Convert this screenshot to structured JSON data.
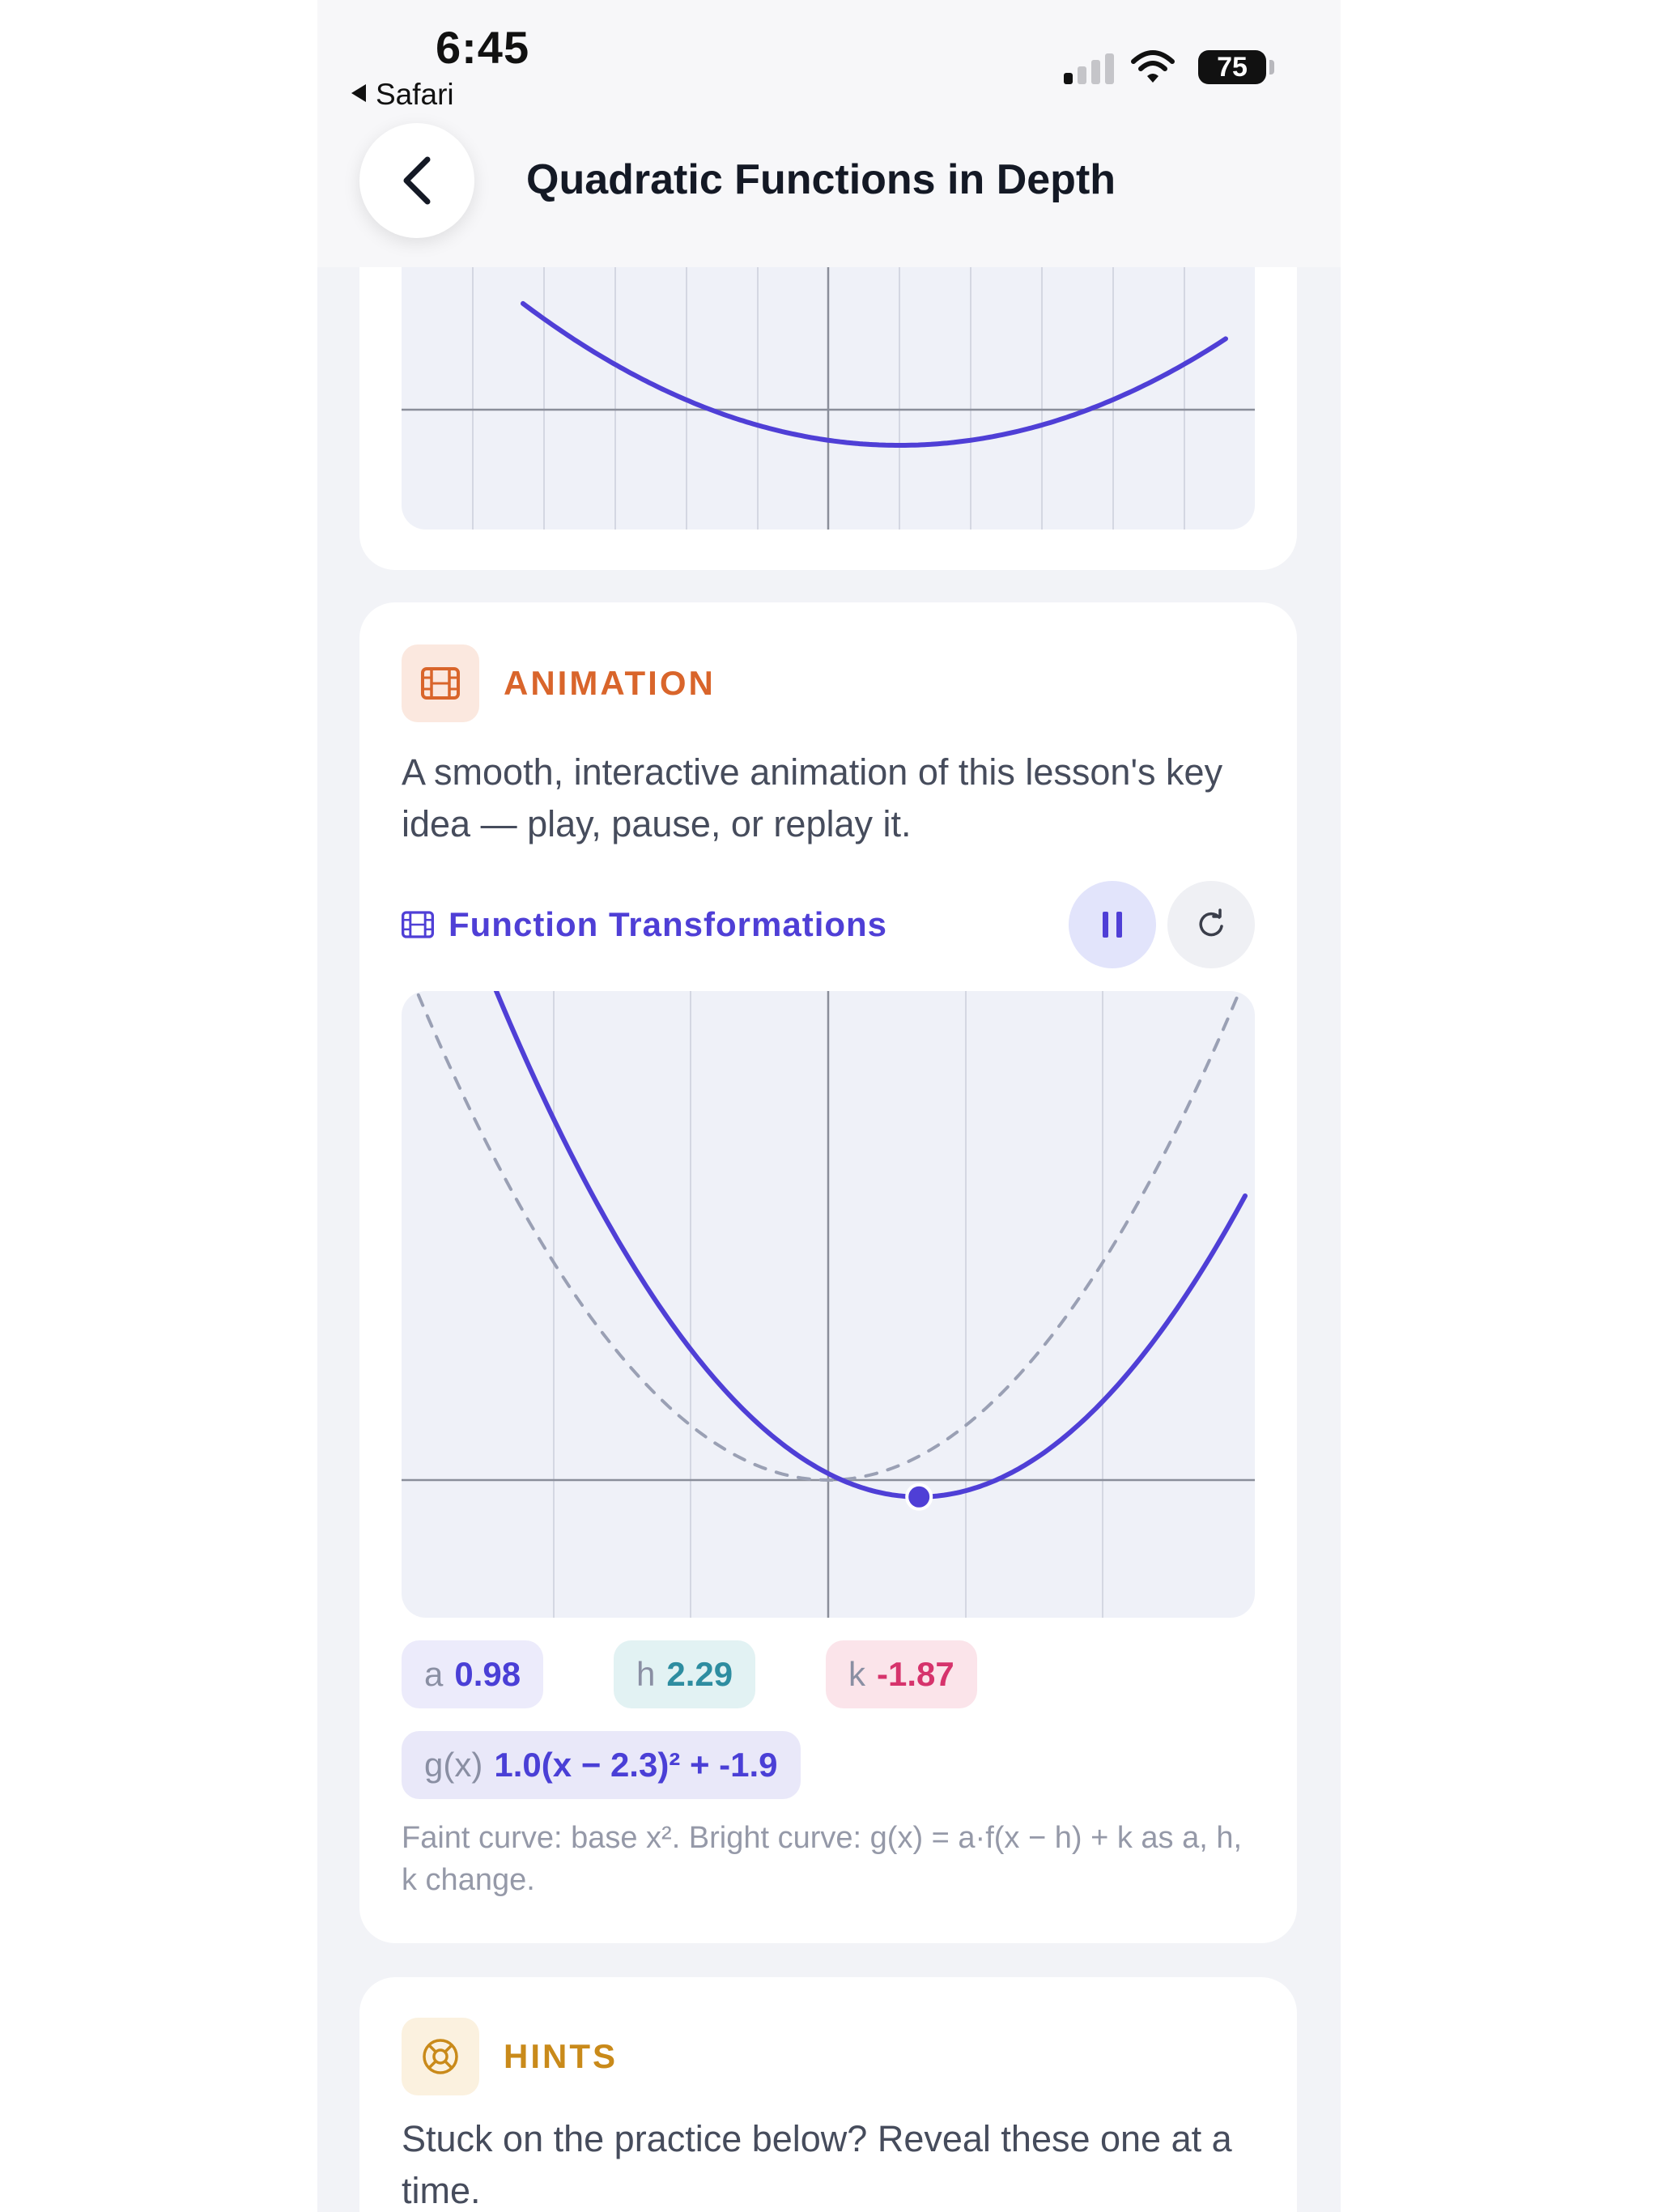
{
  "status_bar": {
    "time": "6:45",
    "back_app": "Safari",
    "battery": "75"
  },
  "nav": {
    "title": "Quadratic Functions in Depth",
    "back_icon": "chevron-left-icon"
  },
  "top_graph": {
    "curve_color": "#4f3fd6"
  },
  "animation_section": {
    "label": "ANIMATION",
    "label_color": "#d9652b",
    "icon": "film-icon",
    "description": "A smooth, interactive animation of this lesson's key idea — play, pause, or replay it.",
    "demo_title": "Function Transformations",
    "pause_icon": "pause-icon",
    "replay_icon": "replay-icon",
    "params": {
      "a": {
        "label": "a",
        "value": "0.98"
      },
      "h": {
        "label": "h",
        "value": "2.29"
      },
      "k": {
        "label": "k",
        "value": "-1.87"
      }
    },
    "formula": {
      "label": "g(x)",
      "value": "1.0(x − 2.3)² + -1.9"
    },
    "caption": "Faint curve: base x². Bright curve: g(x) = a·f(x − h) + k as a, h, k change."
  },
  "hints_section": {
    "label": "HINTS",
    "label_color": "#c98a1a",
    "icon": "lifebuoy-icon",
    "description": "Stuck on the practice below? Reveal these one at a time."
  },
  "colors": {
    "accent": "#4f3fd6",
    "base_curve": "#9aa0b4",
    "grid": "#d4d7e2",
    "axis": "#8a8e9a"
  }
}
